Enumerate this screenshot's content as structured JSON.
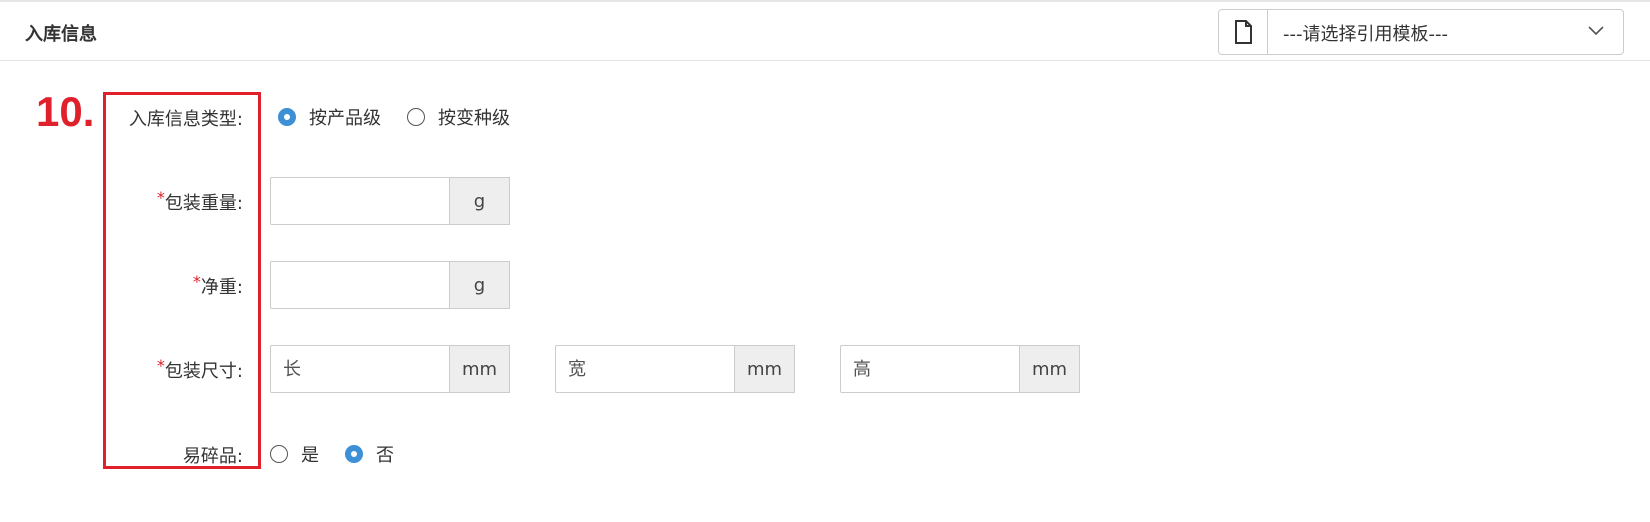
{
  "header": {
    "title": "入库信息"
  },
  "template": {
    "placeholder": "---请选择引用模板---"
  },
  "step": "10.",
  "storage_type": {
    "label": "入库信息类型:",
    "options": [
      "按产品级",
      "按变种级"
    ],
    "selected": "按产品级"
  },
  "package_weight": {
    "required_mark": "*",
    "label": "包装重量:",
    "value": "",
    "unit": "g"
  },
  "net_weight": {
    "required_mark": "*",
    "label": "净重:",
    "value": "",
    "unit": "g"
  },
  "package_size": {
    "required_mark": "*",
    "label": "包装尺寸:",
    "length": {
      "placeholder": "长",
      "unit": "mm"
    },
    "width": {
      "placeholder": "宽",
      "unit": "mm"
    },
    "height": {
      "placeholder": "高",
      "unit": "mm"
    }
  },
  "fragile": {
    "label": "易碎品:",
    "options": [
      "是",
      "否"
    ],
    "selected": "否"
  },
  "colors": {
    "accent": "#3d8fd6",
    "highlight": "#e0202b"
  },
  "icons": {
    "template": "file-icon",
    "dropdown": "chevron-down-icon"
  }
}
